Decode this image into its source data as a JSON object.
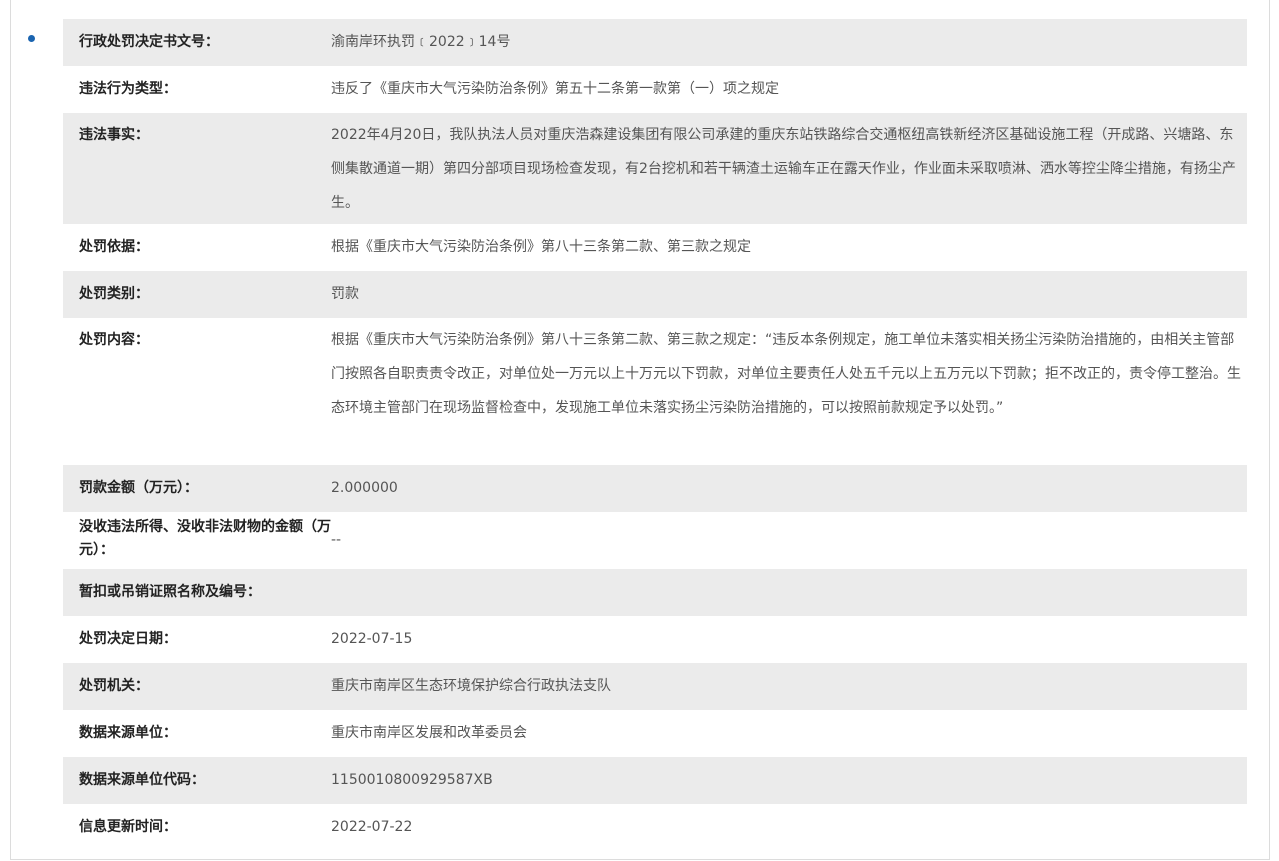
{
  "rows": [
    {
      "label": "行政处罚决定书文号：",
      "value": "渝南岸环执罚﹝2022﹞14号"
    },
    {
      "label": "违法行为类型：",
      "value": "违反了《重庆市大气污染防治条例》第五十二条第一款第（一）项之规定"
    },
    {
      "label": "违法事实：",
      "value": "2022年4月20日，我队执法人员对重庆浩森建设集团有限公司承建的重庆东站铁路综合交通枢纽高铁新经济区基础设施工程（开成路、兴塘路、东侧集散通道一期）第四分部项目现场检查发现，有2台挖机和若干辆渣土运输车正在露天作业，作业面未采取喷淋、洒水等控尘降尘措施，有扬尘产生。"
    },
    {
      "label": "处罚依据：",
      "value": "根据《重庆市大气污染防治条例》第八十三条第二款、第三款之规定"
    },
    {
      "label": "处罚类别：",
      "value": "罚款"
    },
    {
      "label": "处罚内容：",
      "value": "根据《重庆市大气污染防治条例》第八十三条第二款、第三款之规定：“违反本条例规定，施工单位未落实相关扬尘污染防治措施的，由相关主管部门按照各自职责责令改正，对单位处一万元以上十万元以下罚款，对单位主要责任人处五千元以上五万元以下罚款；拒不改正的，责令停工整治。生态环境主管部门在现场监督检查中，发现施工单位未落实扬尘污染防治措施的，可以按照前款规定予以处罚。”"
    },
    {
      "label": "罚款金额（万元）：",
      "value": "2.000000"
    },
    {
      "label": "没收违法所得、没收非法财物的金额（万元）：",
      "value": "--"
    },
    {
      "label": "暂扣或吊销证照名称及编号：",
      "value": ""
    },
    {
      "label": "处罚决定日期：",
      "value": "2022-07-15"
    },
    {
      "label": "处罚机关：",
      "value": "重庆市南岸区生态环境保护综合行政执法支队"
    },
    {
      "label": "数据来源单位：",
      "value": "重庆市南岸区发展和改革委员会"
    },
    {
      "label": "数据来源单位代码：",
      "value": "1150010800929587XB"
    },
    {
      "label": "信息更新时间：",
      "value": "2022-07-22"
    }
  ]
}
